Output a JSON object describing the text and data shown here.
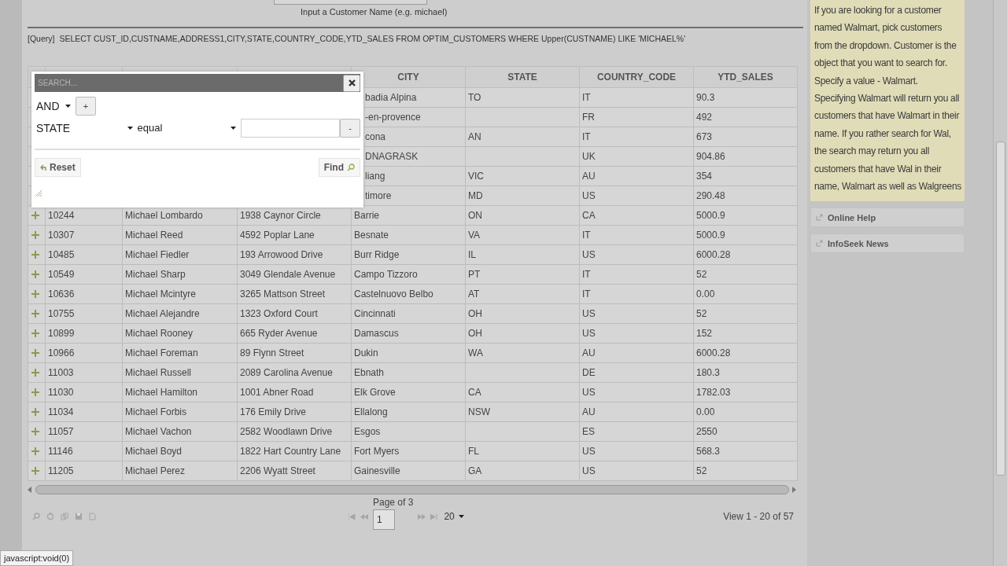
{
  "search_prompt": "Input a Customer Name (e.g. michael)",
  "query": {
    "label": "[Query]",
    "sql": "SELECT CUST_ID,CUSTNAME,ADDRESS1,CITY,STATE,COUNTRY_CODE,YTD_SALES FROM OPTIM_CUSTOMERS WHERE Upper(CUSTNAME) LIKE 'MICHAEL%'"
  },
  "search_dialog": {
    "title": "SEARCH...",
    "group_op": "AND",
    "add_label": "+",
    "rule": {
      "field": "STATE",
      "operator": "equal",
      "remove_label": "-"
    },
    "reset_label": "Reset",
    "find_label": "Find"
  },
  "table": {
    "columns": [
      "CITY",
      "STATE",
      "COUNTRY_CODE",
      "YTD_SALES"
    ],
    "rows": [
      {
        "cells": [
          "badia Alpina",
          "TO",
          "IT",
          "90.3"
        ]
      },
      {
        "cells": [
          "-en-provence",
          null,
          "FR",
          "492"
        ]
      },
      {
        "cells": [
          "cona",
          "AN",
          "IT",
          "673"
        ]
      },
      {
        "cells": [
          "DNAGRASK",
          null,
          "UK",
          "904.86"
        ]
      },
      {
        "cells": [
          "liang",
          "VIC",
          "AU",
          "354"
        ]
      },
      {
        "cells": [
          "timore",
          "MD",
          "US",
          "290.48"
        ]
      },
      {
        "cells": [
          "10244",
          "Michael Lombardo",
          "1938 Caynor Circle",
          "Barrie",
          "ON",
          "CA",
          "5000.9"
        ]
      },
      {
        "cells": [
          "10307",
          "Michael Reed",
          "4592 Poplar Lane",
          "Besnate",
          "VA",
          "IT",
          "5000.9"
        ]
      },
      {
        "cells": [
          "10485",
          "Michael Fiedler",
          "193 Arrowood Drive",
          "Burr Ridge",
          "IL",
          "US",
          "6000.28"
        ]
      },
      {
        "cells": [
          "10549",
          "Michael Sharp",
          "3049 Glendale Avenue",
          "Campo Tizzoro",
          "PT",
          "IT",
          "52"
        ]
      },
      {
        "cells": [
          "10636",
          "Michael Mcintyre",
          "3265 Mattson Street",
          "Castelnuovo Belbo",
          "AT",
          "IT",
          "0.00"
        ]
      },
      {
        "cells": [
          "10755",
          "Michael Alejandre",
          "1323 Oxford Court",
          "Cincinnati",
          "OH",
          "US",
          "52"
        ]
      },
      {
        "cells": [
          "10899",
          "Michael Rooney",
          "665 Ryder Avenue",
          "Damascus",
          "OH",
          "US",
          "152"
        ]
      },
      {
        "cells": [
          "10966",
          "Michael Foreman",
          "89 Flynn Street",
          "Dukin",
          "WA",
          "AU",
          "6000.28"
        ]
      },
      {
        "cells": [
          "11003",
          "Michael Russell",
          "2089 Carolina Avenue",
          "Ebnath",
          null,
          "DE",
          "180.3"
        ]
      },
      {
        "cells": [
          "11030",
          "Michael Hamilton",
          "1001 Abner Road",
          "Elk Grove",
          "CA",
          "US",
          "1782.03"
        ]
      },
      {
        "cells": [
          "11034",
          "Michael Forbis",
          "176 Emily Drive",
          "Ellalong",
          "NSW",
          "AU",
          "0.00"
        ]
      },
      {
        "cells": [
          "11057",
          "Michael Vachon",
          "2582 Woodlawn Drive",
          "Esgos",
          null,
          "ES",
          "2550"
        ]
      },
      {
        "cells": [
          "11146",
          "Michael Boyd",
          "1822 Hart Country Lane",
          "Fort Myers",
          "FL",
          "US",
          "568.3"
        ]
      },
      {
        "cells": [
          "11205",
          "Michael Perez",
          "2206 Wyatt Street",
          "Gainesville",
          "GA",
          "US",
          "52"
        ]
      }
    ]
  },
  "pager": {
    "page_text": "Page  of 3",
    "page_value": "1",
    "page_size": "20",
    "view_info": "View 1 - 20 of 57"
  },
  "help_panel": {
    "text": "If you are looking for a customer named Walmart, pick customers from the dropdown. Customer is the object that you want to search for. Specify a value - Walmart. Specifying Walmart will return you all customers that have Walmart in their name. If you rather search for Wal, the search may return you all customers that have Wal in their name, Walmart as well as Walgreens",
    "links": [
      "Online Help",
      "InfoSeek News"
    ]
  },
  "status_bar": "javascript:void(0)"
}
